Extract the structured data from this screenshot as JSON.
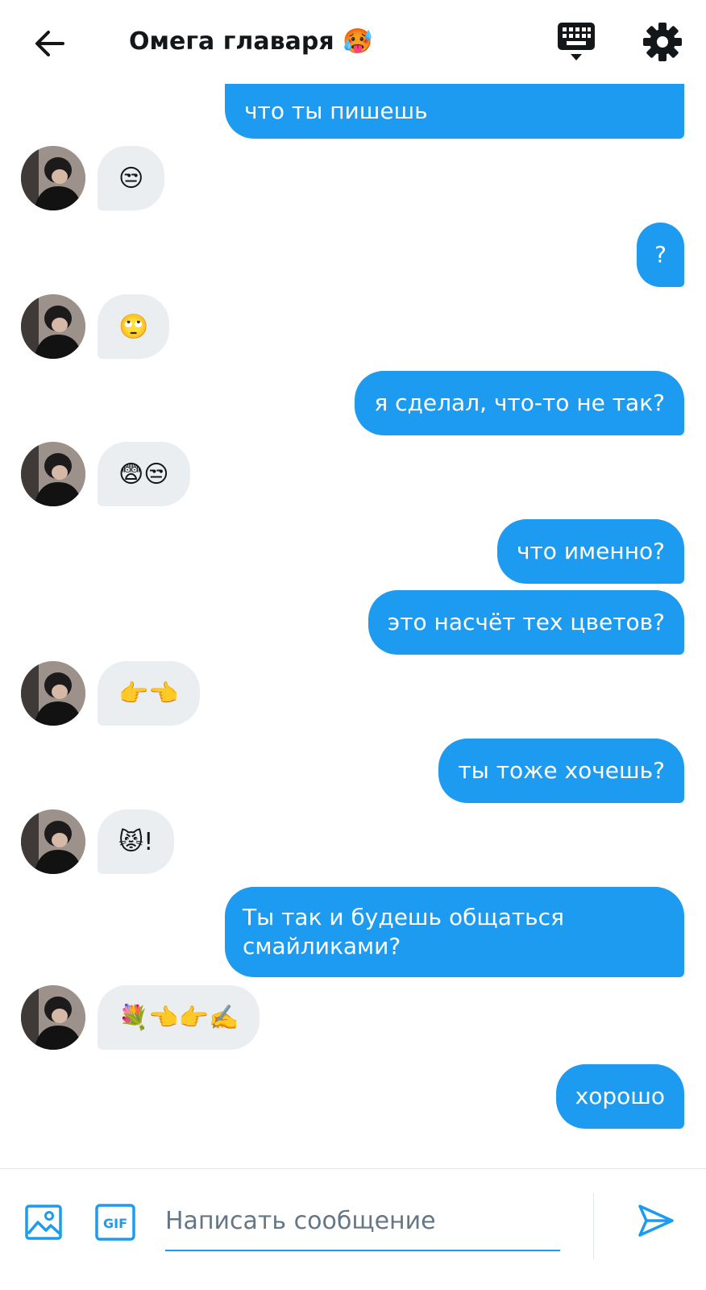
{
  "header": {
    "title": "Омега главаря",
    "title_emoji": "🥵",
    "icons": [
      "back-arrow-icon",
      "keyboard-icon",
      "gear-icon"
    ]
  },
  "messages": [
    {
      "side": "out",
      "text": "что ты пишешь",
      "partial_top": true
    },
    {
      "side": "in",
      "text": "😒"
    },
    {
      "side": "out",
      "text": "?"
    },
    {
      "side": "in",
      "text": "🙄"
    },
    {
      "side": "out",
      "text": "я сделал, что-то не так?"
    },
    {
      "side": "in",
      "text": "😨😒"
    },
    {
      "side": "out",
      "text": "что именно?"
    },
    {
      "side": "out",
      "text": "это насчёт тех цветов?"
    },
    {
      "side": "in",
      "text": "👉👈"
    },
    {
      "side": "out",
      "text": "ты тоже хочешь?"
    },
    {
      "side": "in",
      "text": "😾!"
    },
    {
      "side": "out",
      "text": "Ты так и будешь общаться смайликами?"
    },
    {
      "side": "in",
      "text": "💐👈👉✍️"
    },
    {
      "side": "out",
      "text": "хорошо"
    }
  ],
  "composer": {
    "placeholder": "Написать сообщение",
    "gif_label": "GIF",
    "icons": [
      "image-icon",
      "gif-icon",
      "send-icon"
    ]
  },
  "colors": {
    "accent": "#1d9bf0",
    "incoming_bubble": "#ebeef0",
    "placeholder": "#657786"
  }
}
